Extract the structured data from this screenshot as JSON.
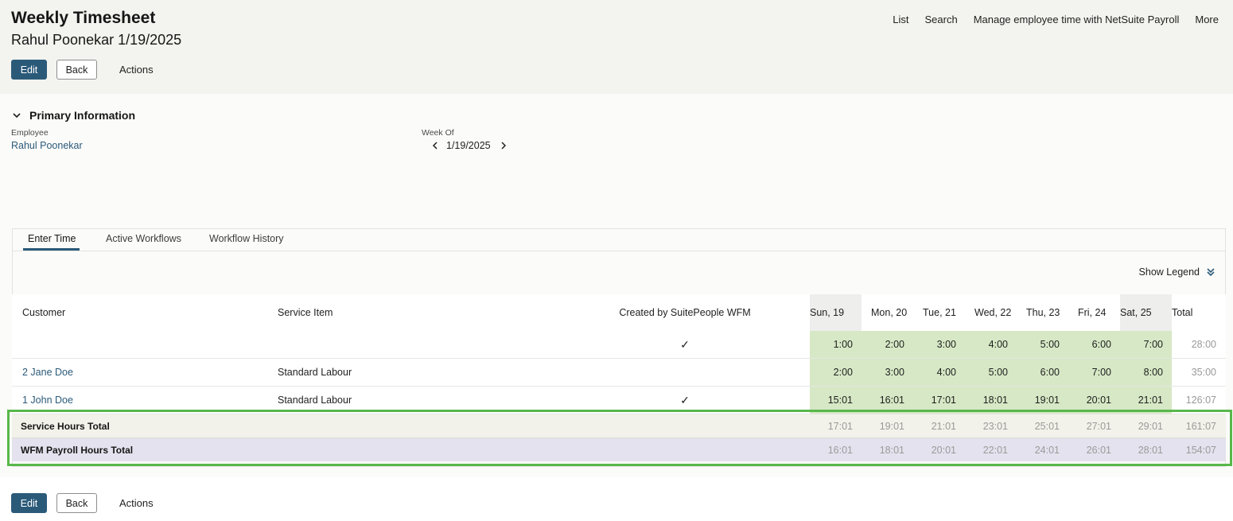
{
  "header": {
    "title": "Weekly Timesheet",
    "subtitle": "Rahul Poonekar 1/19/2025",
    "nav": [
      "List",
      "Search",
      "Manage employee time with NetSuite Payroll",
      "More"
    ]
  },
  "buttons": {
    "edit": "Edit",
    "back": "Back",
    "actions": "Actions"
  },
  "section": {
    "title": "Primary Information"
  },
  "fields": {
    "employee_label": "Employee",
    "employee_value": "Rahul Poonekar",
    "week_label": "Week Of",
    "week_value": "1/19/2025"
  },
  "tabs": [
    "Enter Time",
    "Active Workflows",
    "Workflow History"
  ],
  "legend_label": "Show Legend",
  "table": {
    "columns": {
      "customer": "Customer",
      "service_item": "Service Item",
      "created_by": "Created by SuitePeople WFM",
      "days": [
        "Sun, 19",
        "Mon, 20",
        "Tue, 21",
        "Wed, 22",
        "Thu, 23",
        "Fri, 24",
        "Sat, 25"
      ],
      "total": "Total"
    },
    "rows": [
      {
        "customer": "",
        "service_item": "",
        "created": true,
        "hours": [
          "1:00",
          "2:00",
          "3:00",
          "4:00",
          "5:00",
          "6:00",
          "7:00"
        ],
        "total": "28:00"
      },
      {
        "customer": "2 Jane Doe",
        "service_item": "Standard Labour",
        "created": false,
        "hours": [
          "2:00",
          "3:00",
          "4:00",
          "5:00",
          "6:00",
          "7:00",
          "8:00"
        ],
        "total": "35:00"
      },
      {
        "customer": "1 John Doe",
        "service_item": "Standard Labour",
        "created": true,
        "hours": [
          "15:01",
          "16:01",
          "17:01",
          "18:01",
          "19:01",
          "20:01",
          "21:01"
        ],
        "total": "126:07"
      }
    ],
    "summary": [
      {
        "label": "Service Hours Total",
        "hours": [
          "17:01",
          "19:01",
          "21:01",
          "23:01",
          "25:01",
          "27:01",
          "29:01"
        ],
        "total": "161:07"
      },
      {
        "label": "WFM Payroll Hours Total",
        "hours": [
          "16:01",
          "18:01",
          "20:01",
          "22:01",
          "24:01",
          "26:01",
          "28:01"
        ],
        "total": "154:07"
      }
    ],
    "checkmark": "✓"
  },
  "colors": {
    "primary": "#2b5a79",
    "hours_cell": "#d6e8c5",
    "service_total_row": "#f2f2ea",
    "payroll_total_row": "#e4e2ee",
    "highlight_border": "#58b84a"
  }
}
